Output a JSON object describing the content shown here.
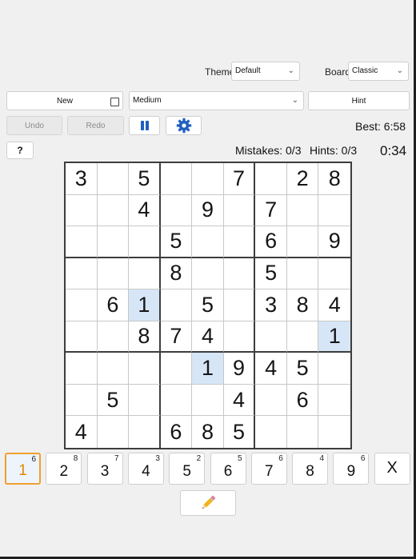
{
  "theme": {
    "label": "Theme",
    "value": "Default"
  },
  "board_style": {
    "label": "Board",
    "value": "Classic"
  },
  "toolbar": {
    "new_label": "New",
    "difficulty": "Medium",
    "hint_label": "Hint",
    "undo_label": "Undo",
    "redo_label": "Redo",
    "help_label": "?"
  },
  "stats": {
    "best": "Best: 6:58",
    "mistakes": "Mistakes: 0/3",
    "hints": "Hints: 0/3",
    "timer": "0:34"
  },
  "colors": {
    "accent": "#1f5fbf",
    "highlight": "#d6e6f7",
    "selected_border": "#f0a030"
  },
  "icons": {
    "pause": "pause-icon",
    "settings": "gear-icon",
    "pencil": "pencil-icon"
  },
  "grid": [
    [
      "3",
      "",
      "5",
      "",
      "",
      "7",
      "",
      "2",
      "8"
    ],
    [
      "",
      "",
      "4",
      "",
      "9",
      "",
      "7",
      "",
      ""
    ],
    [
      "",
      "",
      "",
      "5",
      "",
      "",
      "6",
      "",
      "9"
    ],
    [
      "",
      "",
      "",
      "8",
      "",
      "",
      "5",
      "",
      ""
    ],
    [
      "",
      "6",
      "1",
      "",
      "5",
      "",
      "3",
      "8",
      "4"
    ],
    [
      "",
      "",
      "8",
      "7",
      "4",
      "",
      "",
      "",
      "1"
    ],
    [
      "",
      "",
      "",
      "",
      "1",
      "9",
      "4",
      "5",
      ""
    ],
    [
      "",
      "5",
      "",
      "",
      "",
      "4",
      "",
      "6",
      ""
    ],
    [
      "4",
      "",
      "",
      "6",
      "8",
      "5",
      "",
      "",
      ""
    ]
  ],
  "highlighted_cells": [
    [
      4,
      2
    ],
    [
      5,
      8
    ],
    [
      6,
      4
    ]
  ],
  "numpad": [
    {
      "num": "1",
      "count": "6",
      "selected": true
    },
    {
      "num": "2",
      "count": "8"
    },
    {
      "num": "3",
      "count": "7"
    },
    {
      "num": "4",
      "count": "3"
    },
    {
      "num": "5",
      "count": "2"
    },
    {
      "num": "6",
      "count": "5"
    },
    {
      "num": "7",
      "count": "6"
    },
    {
      "num": "8",
      "count": "4"
    },
    {
      "num": "9",
      "count": "6"
    }
  ],
  "erase_label": "X"
}
